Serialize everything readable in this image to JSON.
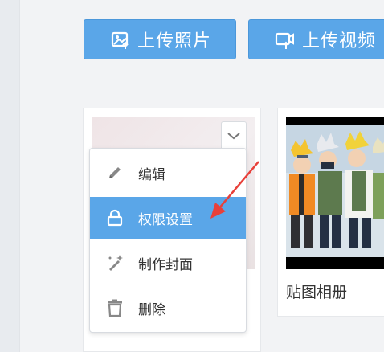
{
  "toolbar": {
    "upload_photo_label": "上传照片",
    "upload_video_label": "上传视频",
    "button_color": "#5aa6e8"
  },
  "album_menu": {
    "items": [
      {
        "label": "编辑",
        "icon": "pencil-icon"
      },
      {
        "label": "权限设置",
        "icon": "lock-icon",
        "highlighted": true
      },
      {
        "label": "制作封面",
        "icon": "magic-wand-icon"
      },
      {
        "label": "删除",
        "icon": "trash-icon"
      }
    ],
    "highlight_color": "#5aa6e8",
    "toggle_icon": "chevron-down-icon"
  },
  "albums": [
    {
      "title": ""
    },
    {
      "title": "贴图相册"
    }
  ],
  "annotation": {
    "arrow_color": "#e8403a"
  }
}
